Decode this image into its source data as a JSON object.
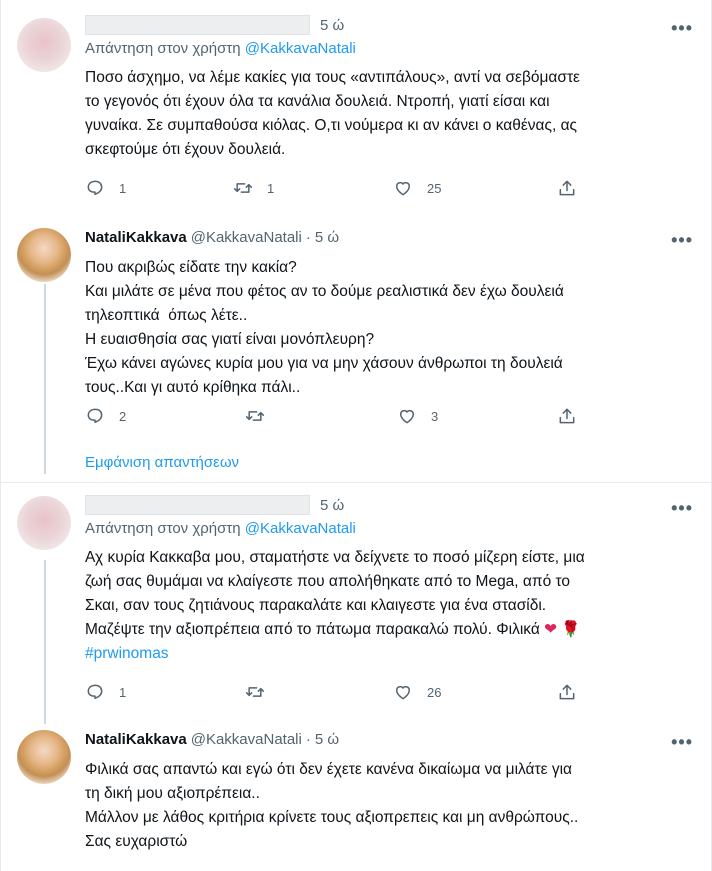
{
  "tweets": [
    {
      "time": "5 ώ",
      "more": "•••",
      "replying_prefix": "Απάντηση στον χρήστη",
      "replying_to": "@KakkavaNatali",
      "lines": [
        "Ποσο άσχημο, να λέμε κακίες για τους «αντιπάλους», αντί να σεβόμαστε",
        "το γεγονός ότι έχουν όλα τα κανάλια δουλειά. Ντροπή, γιατί είσαι και",
        "γυναίκα. Σε συμπαθούσα κιόλας. Ο,τι νούμερα κι αν κάνει ο καθένας, ας",
        "σκεφτούμε ότι έχουν δουλειά."
      ],
      "replies": "1",
      "retweets": "1",
      "likes": "25"
    },
    {
      "name": "NataliKakkava",
      "handle": "@KakkavaNatali",
      "dot": "·",
      "time": "5 ώ",
      "more": "•••",
      "lines": [
        "Που ακριβώς είδατε την κακία?",
        "Και μιλάτε σε μένα που φέτος αν το δούμε ρεαλιστικά δεν έχω δουλειά",
        "τηλεοπτικά  όπως λέτε..",
        "Η ευαισθησία σας γιατί είναι μονόπλευρη?",
        "Έχω κάνει αγώνες κυρία μου για να μην χάσουν άνθρωποι τη δουλειά",
        "τους..Και γι αυτό κρίθηκα πάλι.."
      ],
      "replies": "2",
      "retweets": "",
      "likes": "3"
    },
    {
      "time": "5 ώ",
      "more": "•••",
      "replying_prefix": "Απάντηση στον χρήστη",
      "replying_to": "@KakkavaNatali",
      "lines": [
        "Αχ κυρία Κακκαβα μου, σταματήστε να δείχνετε το ποσό μίζερη είστε, μια",
        "ζωή σας θυμάμαι να κλαίγεστε που απολήθηκατε από το Mega, από το",
        "Σκαι, σαν τους ζητιάνους παρακαλάτε και κλαιγεστε για ένα στασίδι."
      ],
      "last_line": "Μαζέψτε την αξιοπρέπεια από το πάτωμα παρακαλώ πολύ. Φιλικά",
      "heart": "❤",
      "rose": "🌹",
      "hashtag": "#prwinomas",
      "replies": "1",
      "retweets": "",
      "likes": "26"
    },
    {
      "name": "NataliKakkava",
      "handle": "@KakkavaNatali",
      "dot": "·",
      "time": "5 ώ",
      "more": "•••",
      "lines": [
        "Φιλικά σας απαντώ και εγώ ότι δεν έχετε κανένα δικαίωμα να μιλάτε για",
        "τη δική μου αξιοπρέπεια..",
        "Μάλλον με λάθος κριτήρια κρίνετε τους αξιοπρεπεις και μη ανθρώπους..",
        "Σας ευχαριστώ"
      ]
    }
  ],
  "show_replies": "Εμφάνιση απαντήσεων",
  "icons": {
    "reply": "reply-icon",
    "retweet": "retweet-icon",
    "like": "heart-icon",
    "share": "share-icon"
  }
}
